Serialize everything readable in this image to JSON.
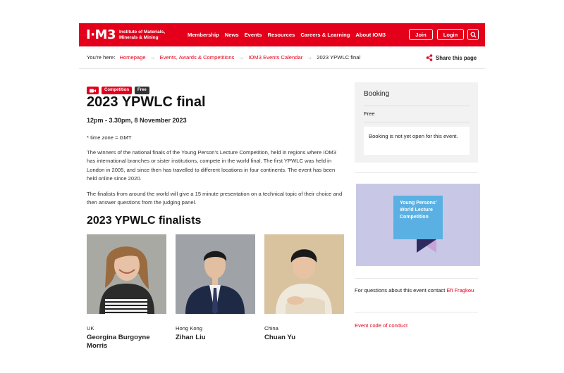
{
  "header": {
    "logo_mark": "I·M3",
    "logo_text": [
      "Institute of Materials,",
      "Minerals & Mining"
    ],
    "nav": [
      "Membership",
      "News",
      "Events",
      "Resources",
      "Careers & Learning",
      "About IOM3"
    ],
    "join_label": "Join",
    "login_label": "Login",
    "accent_color": "#e4001b"
  },
  "breadcrumb": {
    "label": "You're here:",
    "links": [
      "Homepage",
      "Events, Awards & Competitions",
      "IOM3 Events Calendar"
    ],
    "current": "2023 YPWLC final",
    "share_label": "Share this page"
  },
  "event": {
    "tags": [
      "Competition",
      "Free"
    ],
    "title": "2023 YPWLC final",
    "datetime": "12pm - 3.30pm, 8 November 2023",
    "timezone": "* time zone = GMT",
    "paragraphs": [
      "The winners of the national finals of the Young Person's Lecture Competition, held in regions where IOM3 has international branches or sister institutions, compete in the world final. The first YPWLC was held in London in 2005, and since then has travelled to different locations in four continents. The event has been held online since 2020.",
      "The finalists from around the world will give a 15 minute presentation on a technical topic of their choice and then answer questions from the judging panel."
    ],
    "finalists_heading": "2023 YPWLC finalists",
    "finalists": [
      {
        "country": "UK",
        "name": "Georgina Burgoyne Morris"
      },
      {
        "country": "Hong Kong",
        "name": "Zihan Liu"
      },
      {
        "country": "China",
        "name": "Chuan Yu"
      }
    ]
  },
  "sidebar": {
    "booking_title": "Booking",
    "booking_price": "Free",
    "booking_note": "Booking is not yet open for this event.",
    "promo_text": [
      "Young Persons'",
      "World Lecture",
      "Competition"
    ],
    "contact_text": "For questions about this event contact ",
    "contact_name": "Efi Fragkou",
    "conduct_label": "Event code of conduct"
  }
}
